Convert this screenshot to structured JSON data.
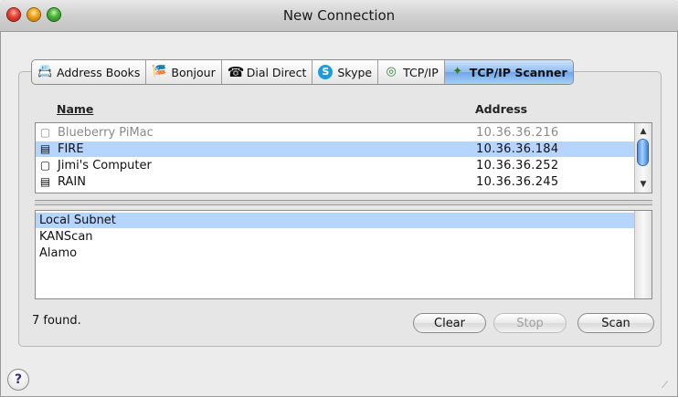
{
  "window": {
    "title": "New Connection"
  },
  "tabs": [
    {
      "label": "Address Books",
      "icon": "address-book-icon",
      "glyph": "📇"
    },
    {
      "label": "Bonjour",
      "icon": "bonjour-icon",
      "glyph": "🎏"
    },
    {
      "label": "Dial Direct",
      "icon": "dial-direct-icon",
      "glyph": "☎"
    },
    {
      "label": "Skype",
      "icon": "skype-icon",
      "glyph": "S"
    },
    {
      "label": "TCP/IP",
      "icon": "tcpip-icon",
      "glyph": "◎"
    },
    {
      "label": "TCP/IP Scanner",
      "icon": "tcpip-scanner-icon",
      "glyph": "✦",
      "active": true
    }
  ],
  "table": {
    "headers": {
      "name": "Name",
      "address": "Address"
    },
    "rows": [
      {
        "name": "Blueberry PiMac",
        "address": "10.36.36.216",
        "icon": "imac-icon",
        "glyph": "▢",
        "dimmed": true
      },
      {
        "name": "FIRE",
        "address": "10.36.36.184",
        "icon": "server-icon",
        "glyph": "▤",
        "selected": true
      },
      {
        "name": "Jimi's Computer",
        "address": "10.36.36.252",
        "icon": "imac-icon",
        "glyph": "▢"
      },
      {
        "name": "RAIN",
        "address": "10.36.36.245",
        "icon": "server-icon",
        "glyph": "▤"
      }
    ]
  },
  "subnets": [
    {
      "label": "Local Subnet",
      "selected": true
    },
    {
      "label": "KANScan"
    },
    {
      "label": "Alamo"
    }
  ],
  "status": {
    "text": "7 found."
  },
  "buttons": {
    "clear": "Clear",
    "stop": "Stop",
    "scan": "Scan"
  },
  "help": {
    "glyph": "?"
  },
  "colors": {
    "selection": "#b5d5ff",
    "active_tab": "#8fbcef"
  }
}
